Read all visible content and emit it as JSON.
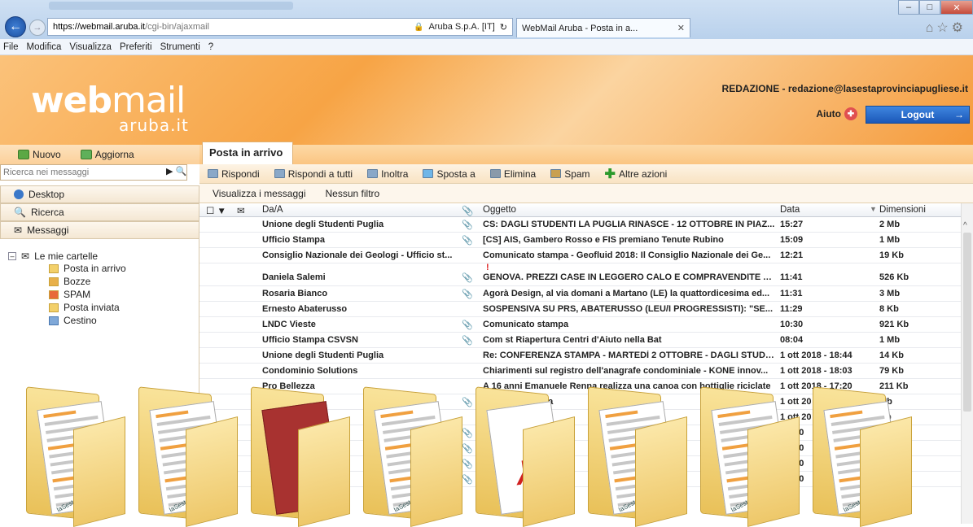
{
  "browser": {
    "url_host": "https://webmail.aruba.it",
    "url_path": "/cgi-bin/ajaxmail",
    "cert": "Aruba S.p.A. [IT]",
    "tab_title": "WebMail Aruba - Posta in a...",
    "menu": [
      "File",
      "Modifica",
      "Visualizza",
      "Preferiti",
      "Strumenti",
      "?"
    ]
  },
  "header": {
    "logo_main": "web",
    "logo_light": "mail",
    "logo_sub": "aruba.it",
    "user": "REDAZIONE - redazione@lasestaprovinciapugliese.it",
    "help": "Aiuto",
    "logout": "Logout"
  },
  "left": {
    "new": "Nuovo",
    "refresh": "Aggiorna",
    "search_placeholder": "Ricerca nei messaggi",
    "nav": [
      "Desktop",
      "Ricerca",
      "Messaggi"
    ],
    "tree_root": "Le mie cartelle",
    "folders": [
      "Posta in arrivo",
      "Bozze",
      "SPAM",
      "Posta inviata",
      "Cestino"
    ]
  },
  "main": {
    "tab": "Posta in arrivo",
    "actions": [
      "Rispondi",
      "Rispondi a tutti",
      "Inoltra",
      "Sposta a",
      "Elimina",
      "Spam",
      "Altre azioni"
    ],
    "filters": [
      "Visualizza i messaggi",
      "Nessun filtro"
    ],
    "columns": {
      "from": "Da/A",
      "subject": "Oggetto",
      "date": "Data",
      "size": "Dimensioni"
    },
    "rows": [
      {
        "from": "Unione degli Studenti Puglia",
        "clip": true,
        "subject": "CS: DAGLI STUDENTI LA PUGLIA RINASCE - 12 OTTOBRE IN PIAZ...",
        "date": "15:27",
        "size": "2 Mb"
      },
      {
        "from": "Ufficio Stampa",
        "clip": true,
        "subject": "[CS] AIS, Gambero Rosso e FIS premiano Tenute Rubino",
        "date": "15:09",
        "size": "1 Mb"
      },
      {
        "from": "Consiglio Nazionale dei Geologi - Ufficio st...",
        "clip": false,
        "subject": "Comunicato stampa - Geofluid 2018: Il Consiglio Nazionale dei Ge...",
        "date": "12:21",
        "size": "19 Kb"
      },
      {
        "from": "Daniela Salemi",
        "clip": true,
        "priority": "!",
        "subject": "GENOVA. PREZZI CASE IN LEGGERO CALO E COMPRAVENDITE A +...",
        "date": "11:41",
        "size": "526 Kb"
      },
      {
        "from": "Rosaria Bianco",
        "clip": true,
        "subject": "Agorà Design, al via domani a Martano (LE) la quattordicesima ed...",
        "date": "11:31",
        "size": "3 Mb"
      },
      {
        "from": "Ernesto Abaterusso",
        "clip": false,
        "subject": "SOSPENSIVA SU PRS, ABATERUSSO (LEU/I PROGRESSISTI): \"SE...",
        "date": "11:29",
        "size": "8 Kb"
      },
      {
        "from": "LNDC Vieste",
        "clip": true,
        "subject": "Comunicato stampa",
        "date": "10:30",
        "size": "921 Kb"
      },
      {
        "from": "Ufficio Stampa CSVSN",
        "clip": true,
        "subject": "Com st Riapertura Centri d'Aiuto nella Bat",
        "date": "08:04",
        "size": "1 Mb"
      },
      {
        "from": "Unione degli Studenti Puglia",
        "clip": false,
        "subject": "Re: CONFERENZA STAMPA - MARTEDÌ 2 OTTOBRE - DAGLI STUDE...",
        "date": "1 ott 2018 - 18:44",
        "size": "14 Kb"
      },
      {
        "from": "Condominio Solutions",
        "clip": false,
        "subject": "Chiarimenti sul registro dell'anagrafe condominiale - KONE innov...",
        "date": "1 ott 2018 - 18:03",
        "size": "79 Kb"
      },
      {
        "from": "Pro Bellezza",
        "clip": false,
        "subject": "A 16 anni Emanuele Renna realizza una canoa con bottiglie riciclate",
        "date": "1 ott 2018 - 17:20",
        "size": "211 Kb"
      },
      {
        "from": "",
        "clip": true,
        "subject": "de del v                ne extra",
        "date": "1 ott 20",
        "size": "Mb"
      },
      {
        "from": "p Corn",
        "clip": false,
        "subject": "Suc               ornata I",
        "date": "1 ott 20",
        "size": "Kb"
      },
      {
        "from": "C.V.)",
        "clip": true,
        "subject": "curo",
        "date": "ott 20",
        "size": ""
      },
      {
        "from": "lo e a",
        "clip": true,
        "subject": "A M",
        "date": "ott 20",
        "size": ""
      },
      {
        "from": "N",
        "clip": true,
        "subject": "ond         r vol",
        "date": "ott 20",
        "size": ""
      },
      {
        "from": "",
        "clip": true,
        "subject": "QUA          ART",
        "date": "ott 20",
        "size": ""
      }
    ]
  },
  "overlay": {
    "folder_label": "laSestaprovinciapugliese"
  }
}
